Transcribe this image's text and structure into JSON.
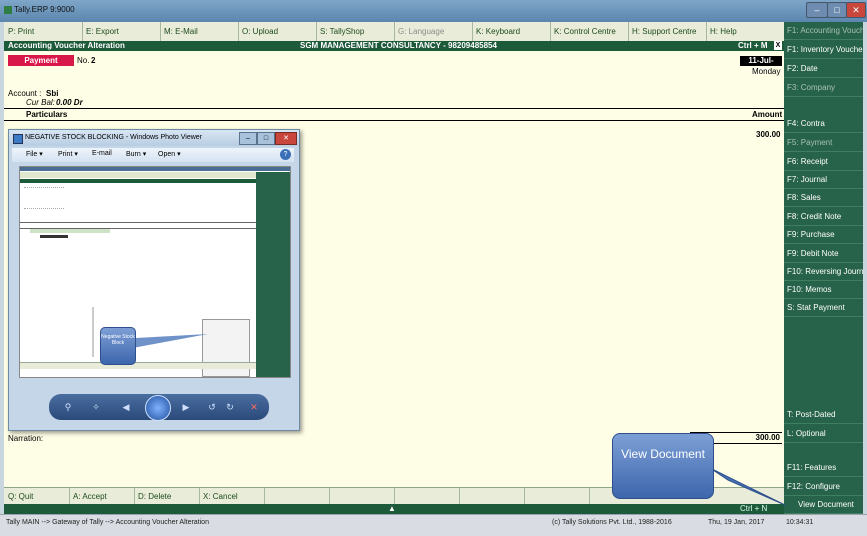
{
  "window": {
    "title": "Tally.ERP 9:9000"
  },
  "top_menu": [
    {
      "key": "P",
      "label": "P: Print"
    },
    {
      "key": "E",
      "label": "E: Export"
    },
    {
      "key": "M",
      "label": "M: E-Mail"
    },
    {
      "key": "O",
      "label": "O: Upload"
    },
    {
      "key": "S",
      "label": "S: TallyShop"
    },
    {
      "key": "G",
      "label": "G: Language"
    },
    {
      "key": "K",
      "label": "K: Keyboard"
    },
    {
      "key": "K",
      "label": "K: Control Centre"
    },
    {
      "key": "H",
      "label": "H: Support Centre"
    },
    {
      "key": "H",
      "label": "H: Help"
    }
  ],
  "header": {
    "screen_title": "Accounting Voucher  Alteration",
    "company": "SGM MANAGEMENT CONSULTANCY - 98209485854",
    "shortcut": "Ctrl + M",
    "close": "X"
  },
  "voucher": {
    "type": "Payment",
    "no_label": "No.",
    "no_value": "2",
    "date": "11-Jul-2016",
    "day": "Monday",
    "account_label": "Account :",
    "account_value": "Sbi",
    "cur_bal_label": "Cur Bal:",
    "cur_bal_value": "0.00 Dr",
    "col_particulars": "Particulars",
    "col_amount": "Amount",
    "line_amount": "300.00",
    "narration_label": "Narration:",
    "total_amount": "300.00"
  },
  "right_panel": [
    {
      "label": "F1: Accounting Vouchers",
      "disabled": true
    },
    {
      "label": "F1: Inventory Vouchers",
      "disabled": false
    },
    {
      "label": "F2: Date",
      "disabled": false
    },
    {
      "label": "F3: Company",
      "disabled": true
    },
    {
      "label": "F4: Contra",
      "disabled": false
    },
    {
      "label": "F5: Payment",
      "disabled": true
    },
    {
      "label": "F6: Receipt",
      "disabled": false
    },
    {
      "label": "F7: Journal",
      "disabled": false
    },
    {
      "label": "F8: Sales",
      "disabled": false
    },
    {
      "label": "F8: Credit Note",
      "disabled": false
    },
    {
      "label": "F9: Purchase",
      "disabled": false
    },
    {
      "label": "F9: Debit Note",
      "disabled": false
    },
    {
      "label": "F10: Reversing Journal",
      "disabled": false
    },
    {
      "label": "F10: Memos",
      "disabled": false
    },
    {
      "label": "S: Stat Payment",
      "disabled": false
    },
    {
      "label": "T: Post-Dated",
      "disabled": false
    },
    {
      "label": "L: Optional",
      "disabled": false
    },
    {
      "label": "F11: Features",
      "disabled": false
    },
    {
      "label": "F12: Configure",
      "disabled": false
    },
    {
      "label": "View Document",
      "disabled": false
    }
  ],
  "bottom_menu": [
    {
      "label": "Q: Quit"
    },
    {
      "label": "A: Accept"
    },
    {
      "label": "D: Delete"
    },
    {
      "label": "X: Cancel"
    }
  ],
  "bottom_shortcut": "Ctrl + N",
  "status_bar": {
    "path": "Tally MAIN --> Gateway of Tally --> Accounting Voucher  Alteration",
    "copyright": "(c) Tally Solutions Pvt. Ltd., 1988-2016",
    "date": "Thu, 19 Jan, 2017",
    "time": "10:34:31"
  },
  "photo_viewer": {
    "title": "NEGATIVE STOCK BLOCKING - Windows Photo Viewer",
    "menu": [
      "File",
      "Print",
      "E-mail",
      "Burn",
      "Open"
    ],
    "inner_callout": "Negative Stock Block"
  },
  "callout_view_document": "View Document",
  "colors": {
    "tally_green": "#27624a",
    "header_green": "#1d5a39",
    "voucher_red": "#d9184a",
    "callout_blue": "#4a74b8"
  }
}
